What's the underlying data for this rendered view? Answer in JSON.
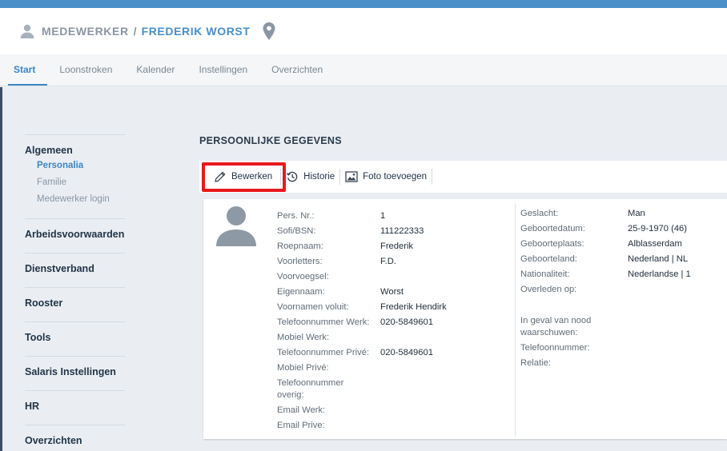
{
  "header": {
    "breadcrumb_root": "MEDEWERKER",
    "separator": "/",
    "employee_name": "FREDERIK WORST",
    "icons": {
      "user": "user-icon",
      "location": "map-pin-icon"
    }
  },
  "tabs": [
    {
      "label": "Start",
      "active": true
    },
    {
      "label": "Loonstroken",
      "active": false
    },
    {
      "label": "Kalender",
      "active": false
    },
    {
      "label": "Instellingen",
      "active": false
    },
    {
      "label": "Overzichten",
      "active": false
    }
  ],
  "sidebar": {
    "algemeen": {
      "label": "Algemeen",
      "items": [
        "Personalia",
        "Familie",
        "Medewerker login"
      ]
    },
    "groups": [
      "Arbeidsvoorwaarden",
      "Dienstverband",
      "Rooster",
      "Tools",
      "Salaris Instellingen",
      "HR",
      "Overzichten"
    ]
  },
  "section_title": "PERSOONLIJKE GEGEVENS",
  "toolbar": {
    "edit_label": "Bewerken",
    "history_label": "Historie",
    "photo_label": "Foto toevoegen",
    "icons": {
      "edit": "pencil-icon",
      "history": "history-icon",
      "photo": "image-icon"
    }
  },
  "personal_left": [
    {
      "label": "Pers. Nr.:",
      "value": "1"
    },
    {
      "label": "Sofi/BSN:",
      "value": "111222333"
    },
    {
      "label": "Roepnaam:",
      "value": "Frederik"
    },
    {
      "label": "Voorletters:",
      "value": "F.D."
    },
    {
      "label": "Voorvoegsel:",
      "value": ""
    },
    {
      "label": "Eigennaam:",
      "value": "Worst"
    },
    {
      "label": "Voornamen voluit:",
      "value": "Frederik Hendirk"
    },
    {
      "label": "Telefoonnummer Werk:",
      "value": "020-5849601"
    },
    {
      "label": "Mobiel Werk:",
      "value": ""
    },
    {
      "label": "Telefoonnummer Privé:",
      "value": "020-5849601"
    },
    {
      "label": "Mobiel Privé:",
      "value": ""
    },
    {
      "label": "Telefoonnummer overig:",
      "value": ""
    },
    {
      "label": "Email Werk:",
      "value": ""
    },
    {
      "label": "Email Prive:",
      "value": ""
    }
  ],
  "personal_right": [
    {
      "label": "Geslacht:",
      "value": "Man"
    },
    {
      "label": "Geboortedatum:",
      "value": "25-9-1970 (46)"
    },
    {
      "label": "Geboorteplaats:",
      "value": "Alblasserdam"
    },
    {
      "label": "Geboorteland:",
      "value": "Nederland | NL"
    },
    {
      "label": "Nationaliteit:",
      "value": "Nederlandse | 1"
    },
    {
      "label": "Overleden op:",
      "value": ""
    }
  ],
  "emergency": [
    {
      "label": "In geval van nood waarschuwen:",
      "value": ""
    },
    {
      "label": "Telefoonnummer:",
      "value": ""
    },
    {
      "label": "Relatie:",
      "value": ""
    }
  ],
  "colors": {
    "accent": "#4a8fc8",
    "highlight": "#e8191e",
    "sidebar_text": "#223447"
  }
}
